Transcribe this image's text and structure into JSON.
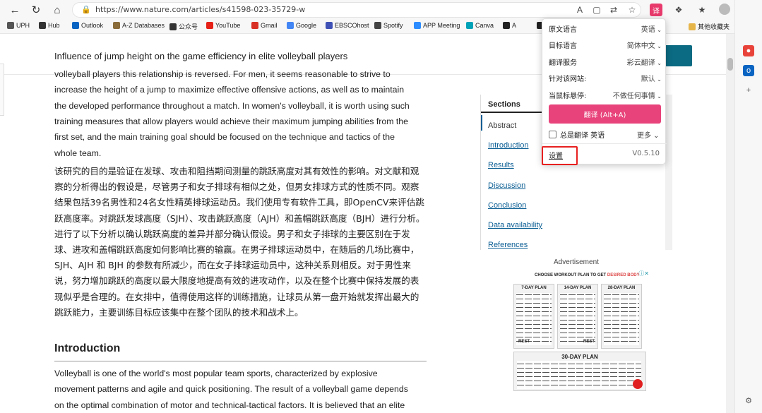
{
  "browser": {
    "url": "https://www.nature.com/articles/s41598-023-35729-w",
    "bookmarks": [
      {
        "label": "UPH",
        "color": "#555555"
      },
      {
        "label": "Hub",
        "color": "#333333"
      },
      {
        "label": "Outlook",
        "color": "#0a64c2"
      },
      {
        "label": "A-Z Databases",
        "color": "#8a6d3b"
      },
      {
        "label": "公众号",
        "color": "#333333"
      },
      {
        "label": "YouTube",
        "color": "#e62117"
      },
      {
        "label": "Gmail",
        "color": "#d93025"
      },
      {
        "label": "Google",
        "color": "#4285f4"
      },
      {
        "label": "EBSCOhost",
        "color": "#3f51b5"
      },
      {
        "label": "Spotify",
        "color": "#444444"
      },
      {
        "label": "APP Meeting",
        "color": "#2d8cff"
      },
      {
        "label": "Canva",
        "color": "#00a2b8"
      },
      {
        "label": "A",
        "color": "#222222"
      },
      {
        "label": "S",
        "color": "#222222"
      }
    ],
    "other_bookmarks": "其他收藏夹"
  },
  "article": {
    "header_title": "Influence of jump height on the game efficiency in elite volleyball players",
    "english_lines": [
      "volleyball players this relationship is reversed. For men, it seems reasonable to strive to",
      "increase the height of a jump to maximize effective offensive actions, as well as to maintain",
      "the developed performance throughout a match. In women's volleyball, it is worth using such",
      "training measures that allow players would achieve their maximum jumping abilities from the",
      "first set, and the main training goal should be focused on the technique and tactics of the",
      "whole team."
    ],
    "chinese_paragraph": "该研究的目的是验证在发球、攻击和阻挡期间测量的跳跃高度对其有效性的影响。对文献和观察的分析得出的假设是，尽管男子和女子排球有相似之处，但男女排球方式的性质不同。观察结果包括39名男性和24名女性精英排球运动员。我们使用专有软件工具，即OpenCV来评估跳跃高度率。对跳跃发球高度（SJH）、攻击跳跃高度（AJH）和盖帽跳跃高度（BJH）进行分析。进行了以下分析以确认跳跃高度的差异并部分确认假设。男子和女子排球的主要区别在于发球、进攻和盖帽跳跃高度如何影响比赛的输赢。在男子排球运动员中，在随后的几场比赛中，SJH、AJH 和 BJH 的参数有所减少，而在女子排球运动员中，这种关系则相反。对于男性来说，努力增加跳跃的高度以最大限度地提高有效的进攻动作，以及在整个比赛中保持发展的表现似乎是合理的。在女排中，值得使用这样的训练措施，让球员从第一盘开始就发挥出最大的跳跃能力，主要训练目标应该集中在整个团队的技术和战术上。",
    "intro_heading": "Introduction",
    "intro_lines": [
      "Volleyball is one of the world's most popular team sports, characterized by explosive",
      "movement patterns and agile and quick positioning. The result of a volleyball game depends",
      "on the optimal combination of motor and technical-tactical factors. It is believed that an elite"
    ]
  },
  "sections_nav": {
    "title": "Sections",
    "items": [
      "Abstract",
      "Introduction",
      "Results",
      "Discussion",
      "Conclusion",
      "Data availability",
      "References"
    ]
  },
  "ad": {
    "label": "Advertisement",
    "headline_prefix": "CHOOSE WORKOUT PLAN TO GET ",
    "headline_highlight": "DESIRED BODY",
    "plans": [
      "7-DAY PLAN",
      "14-DAY PLAN",
      "28-DAY PLAN"
    ],
    "rest_label": "REST",
    "plan30": "30-DAY PLAN"
  },
  "translate_popup": {
    "rows": [
      {
        "label": "原文语言",
        "value": "英语"
      },
      {
        "label": "目标语言",
        "value": "简体中文"
      },
      {
        "label": "翻译服务",
        "value": "彩云翻译"
      },
      {
        "label": "针对该网站:",
        "value": "默认"
      },
      {
        "label": "当鼠标悬停:",
        "value": "不做任何事情"
      }
    ],
    "translate_button": "翻译 (Alt+A)",
    "always_translate": "总是翻译 英语",
    "more": "更多",
    "settings": "设置",
    "version": "V0.5.10"
  }
}
